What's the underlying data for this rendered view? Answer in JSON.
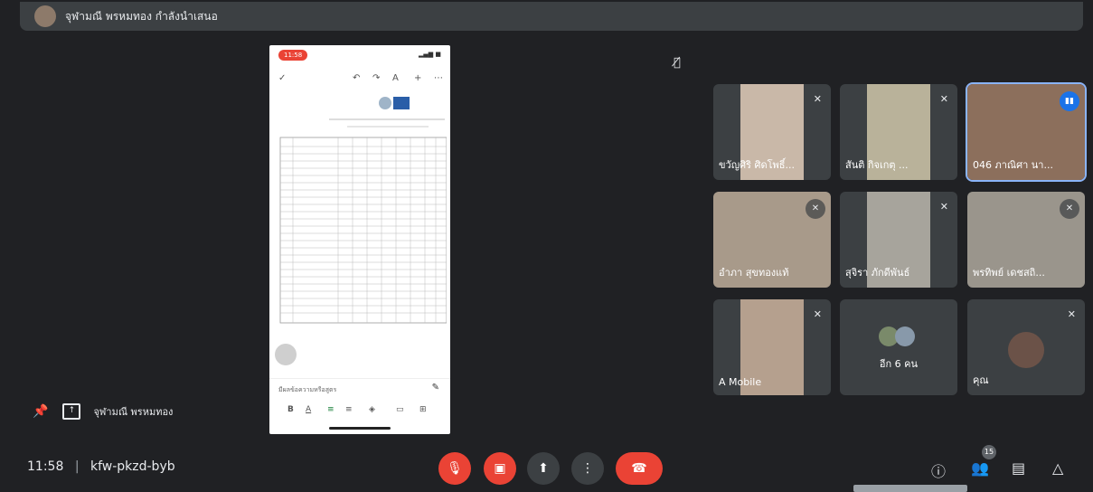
{
  "presenter_banner": {
    "name": "จุฬามณี พรหมทอง กำลังนำเสนอ"
  },
  "presentation": {
    "phone_time": "11:58",
    "form_field_label": "มีผลข้อความหรือสูตร"
  },
  "participants": [
    {
      "name": "ขวัญศิริ ศิดโพธิ์...",
      "muted": true
    },
    {
      "name": "สันติ กิจเกตุ ...",
      "muted": true
    },
    {
      "name": "046 ภาณิศา นา...",
      "muted": false,
      "speaking": true
    },
    {
      "name": "อำภา สุขทองแท้",
      "muted": true
    },
    {
      "name": "สุจิรา ภักดีพันธ์",
      "muted": true
    },
    {
      "name": "พรทิพย์ เดชสถิ...",
      "muted": true
    },
    {
      "name": "A Mobile",
      "muted": true
    },
    {
      "name": "อีก 6 คน"
    },
    {
      "name": "คุณ",
      "muted": true
    }
  ],
  "pinned": {
    "name": "จุฬามณี พรหมทอง"
  },
  "meeting": {
    "time": "11:58",
    "separator": "|",
    "code": "kfw-pkzd-byb"
  },
  "people_count": "15",
  "colors": {
    "background": "#202124",
    "tile": "#3c4043",
    "red": "#ea4335",
    "accent": "#8ab4f8"
  }
}
